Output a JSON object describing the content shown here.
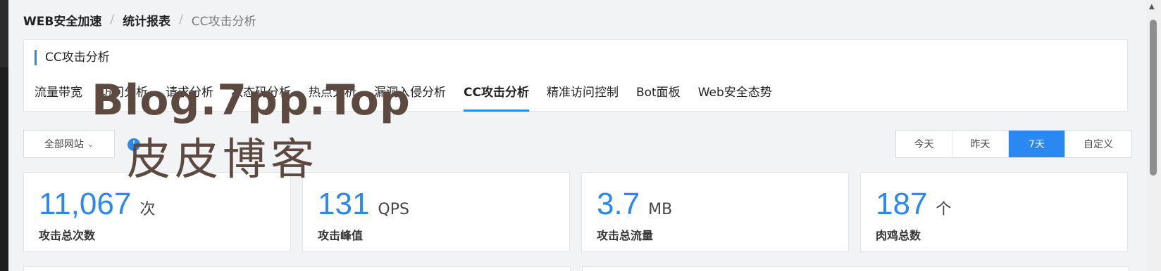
{
  "breadcrumb": [
    "WEB安全加速",
    "统计报表",
    "CC攻击分析"
  ],
  "panel": {
    "title": "CC攻击分析",
    "tabs": [
      "流量带宽",
      "访问分析",
      "请求分析",
      "状态码分析",
      "热点分析",
      "漏洞入侵分析",
      "CC攻击分析",
      "精准访问控制",
      "Bot面板",
      "Web安全态势"
    ],
    "active_tab": "CC攻击分析"
  },
  "site_select": {
    "value": "全部网站"
  },
  "watermark": {
    "en": "Blog.7pp.Top",
    "zh": "皮皮博客"
  },
  "time_range": {
    "options": [
      "今天",
      "昨天",
      "7天",
      "自定义"
    ],
    "selected": "7天"
  },
  "cards": [
    {
      "value": "11,067",
      "unit": "次",
      "label": "攻击总次数"
    },
    {
      "value": "131",
      "unit": "QPS",
      "label": "攻击峰值"
    },
    {
      "value": "3.7",
      "unit": "MB",
      "label": "攻击总流量"
    },
    {
      "value": "187",
      "unit": "个",
      "label": "肉鸡总数"
    }
  ],
  "colors": {
    "accent": "#2b88f0",
    "background": "#f2f3f5"
  }
}
